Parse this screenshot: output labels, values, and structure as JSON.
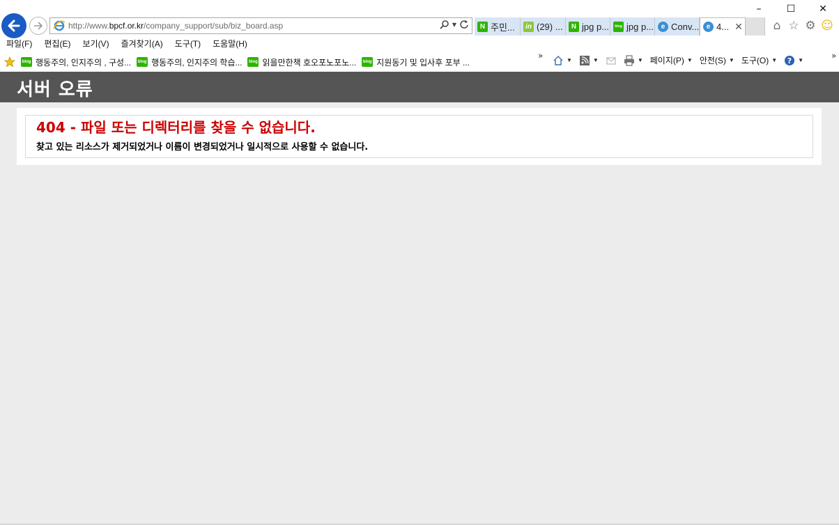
{
  "window": {
    "minimize": "–",
    "maximize": "☐",
    "close": "✕"
  },
  "address_bar": {
    "url_prefix": "http://www.",
    "url_domain": "bpcf.or.kr",
    "url_path": "/company_support/sub/biz_board.asp"
  },
  "tabs": [
    {
      "label": "주민...",
      "icon": "naver-icon",
      "badge": "N",
      "color": "#2db400"
    },
    {
      "label": "(29) ...",
      "icon": "indeed-icon",
      "badge": "in",
      "color": "#8dc63f"
    },
    {
      "label": "jpg p...",
      "icon": "naver-icon",
      "badge": "N",
      "color": "#2db400"
    },
    {
      "label": "jpg p...",
      "icon": "blog-icon",
      "badge": "blog",
      "color": "#2db400"
    },
    {
      "label": "Conv...",
      "icon": "ie-icon",
      "badge": "e",
      "color": "#3b8fd6"
    },
    {
      "label": "4...",
      "icon": "ie-icon",
      "badge": "e",
      "color": "#3b8fd6",
      "active": true
    }
  ],
  "menu": [
    "파일(F)",
    "편집(E)",
    "보기(V)",
    "즐겨찾기(A)",
    "도구(T)",
    "도움말(H)"
  ],
  "favorites": [
    "행동주의, 인지주의 , 구성...",
    "행동주의, 인지주의 학습...",
    "읽을만한책 호오포노포노...",
    "지원동기 및 입사후 포부 ..."
  ],
  "favorite_badge": "blog",
  "command_bar": {
    "page": "페이지(P)",
    "safety": "안전(S)",
    "tools": "도구(O)"
  },
  "page": {
    "header": "서버 오류",
    "error_title": "404 - 파일 또는 디렉터리를 찾을 수 없습니다.",
    "error_detail": "찾고 있는 리소스가 제거되었거나 이름이 변경되었거나 일시적으로 사용할 수 없습니다."
  },
  "colors": {
    "header_band": "#555555",
    "error_red": "#cc0000",
    "page_bg": "#ececec"
  }
}
